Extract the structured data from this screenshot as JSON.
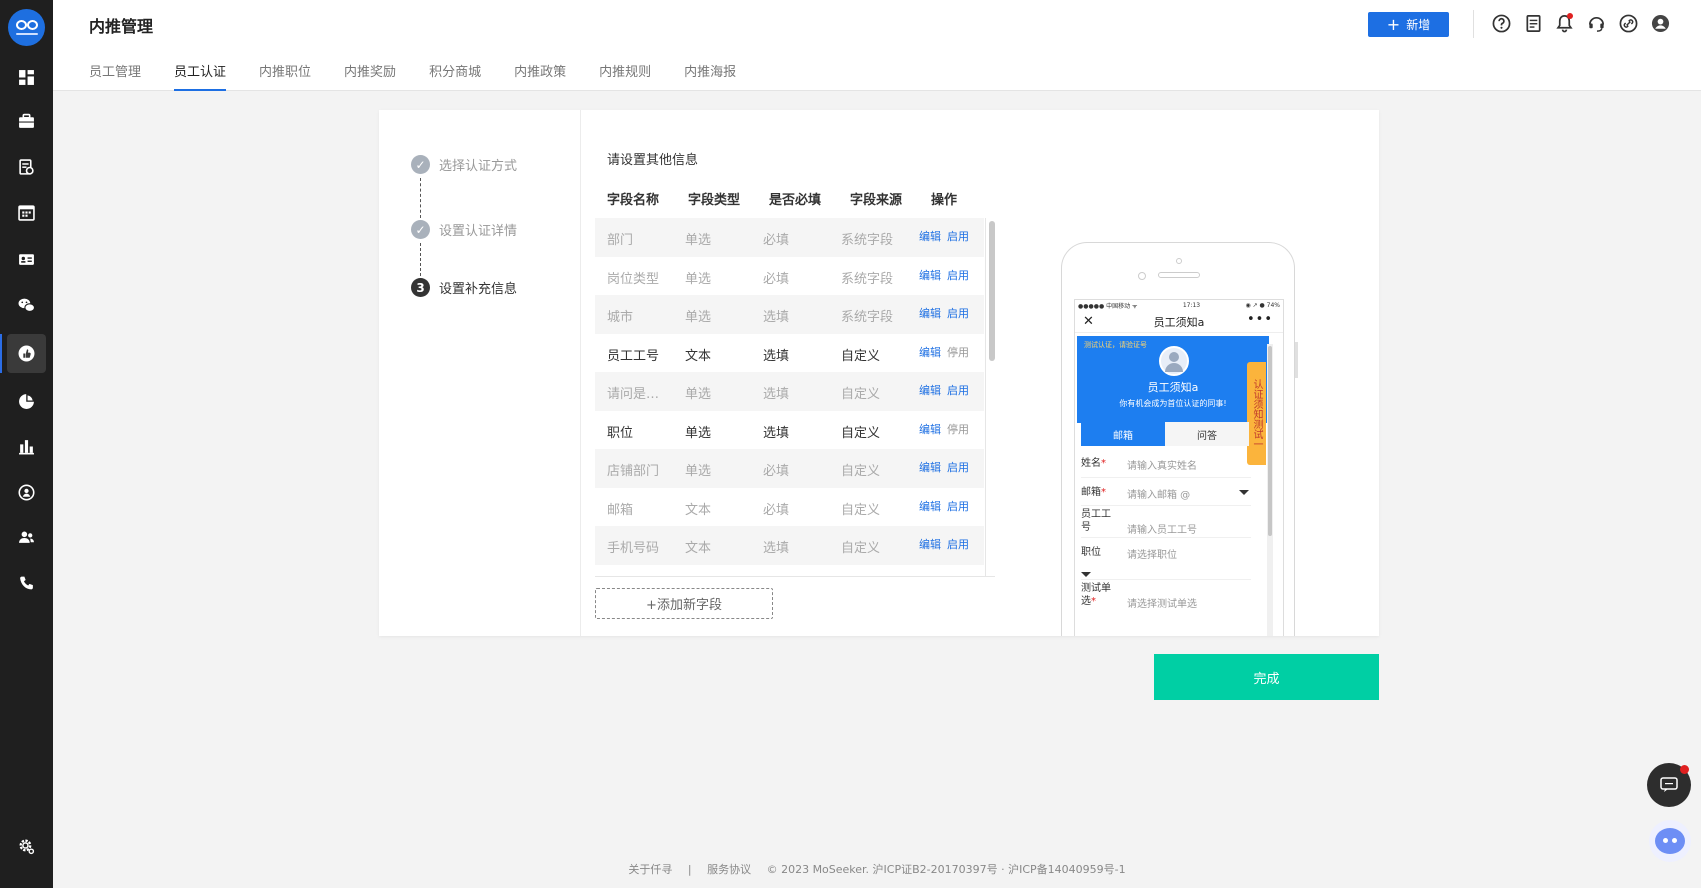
{
  "header": {
    "title": "内推管理",
    "add_label": "新增"
  },
  "tabs": [
    "员工管理",
    "员工认证",
    "内推职位",
    "内推奖励",
    "积分商城",
    "内推政策",
    "内推规则",
    "内推海报"
  ],
  "steps": [
    "选择认证方式",
    "设置认证详情",
    "设置补充信息"
  ],
  "current_step_number": "3",
  "section_title": "请设置其他信息",
  "table": {
    "headers": [
      "字段名称",
      "字段类型",
      "是否必填",
      "字段来源",
      "操作"
    ],
    "rows": [
      {
        "name": "部门",
        "type": "单选",
        "required": "必填",
        "source": "系统字段",
        "edit": "编辑",
        "toggle": "启用"
      },
      {
        "name": "岗位类型",
        "type": "单选",
        "required": "必填",
        "source": "系统字段",
        "edit": "编辑",
        "toggle": "启用"
      },
      {
        "name": "城市",
        "type": "单选",
        "required": "选填",
        "source": "系统字段",
        "edit": "编辑",
        "toggle": "启用"
      },
      {
        "name": "员工工号",
        "type": "文本",
        "required": "选填",
        "source": "自定义",
        "edit": "编辑",
        "toggle": "停用"
      },
      {
        "name": "请问是…",
        "type": "单选",
        "required": "选填",
        "source": "自定义",
        "edit": "编辑",
        "toggle": "启用"
      },
      {
        "name": "职位",
        "type": "单选",
        "required": "选填",
        "source": "自定义",
        "edit": "编辑",
        "toggle": "停用"
      },
      {
        "name": "店铺部门",
        "type": "单选",
        "required": "必填",
        "source": "自定义",
        "edit": "编辑",
        "toggle": "启用"
      },
      {
        "name": "邮箱",
        "type": "文本",
        "required": "必填",
        "source": "自定义",
        "edit": "编辑",
        "toggle": "启用"
      },
      {
        "name": "手机号码",
        "type": "文本",
        "required": "选填",
        "source": "自定义",
        "edit": "编辑",
        "toggle": "启用"
      }
    ]
  },
  "add_field_label": "+添加新字段",
  "preview": {
    "status_left": "●●●●● 中国移动 ᯤ",
    "status_time": "17:13",
    "status_right": "◉ ↗ ● 74%",
    "close": "✕",
    "more": "•••",
    "nav_title": "员工须知a",
    "banner_tag": "测试认证，请验证号",
    "banner_name": "员工须知a",
    "banner_sub": "你有机会成为首位认证的同事!",
    "ribbon": "认证须知测试一",
    "seg_tabs": [
      "邮箱",
      "问答"
    ],
    "fields": [
      {
        "label": "姓名",
        "required": "*",
        "placeholder": "请输入真实姓名"
      },
      {
        "label": "邮箱",
        "required": "*",
        "placeholder": "请输入邮箱 @"
      },
      {
        "label": "员工工号",
        "required": "",
        "placeholder": "请输入员工工号"
      },
      {
        "label": "职位",
        "required": "",
        "placeholder": "请选择职位"
      },
      {
        "label": "测试单选",
        "required": "*",
        "placeholder": "请选择测试单选"
      }
    ]
  },
  "done_label": "完成",
  "footer": {
    "about": "关于仟寻",
    "sep": "|",
    "terms": "服务协议",
    "copyright": "© 2023 MoSeeker. 沪ICP证B2-20170397号 · 沪ICP备14040959号-1"
  },
  "colors": {
    "primary": "#1d6fe3",
    "done": "#00cfa4",
    "sidebar": "#1f1f1f"
  }
}
